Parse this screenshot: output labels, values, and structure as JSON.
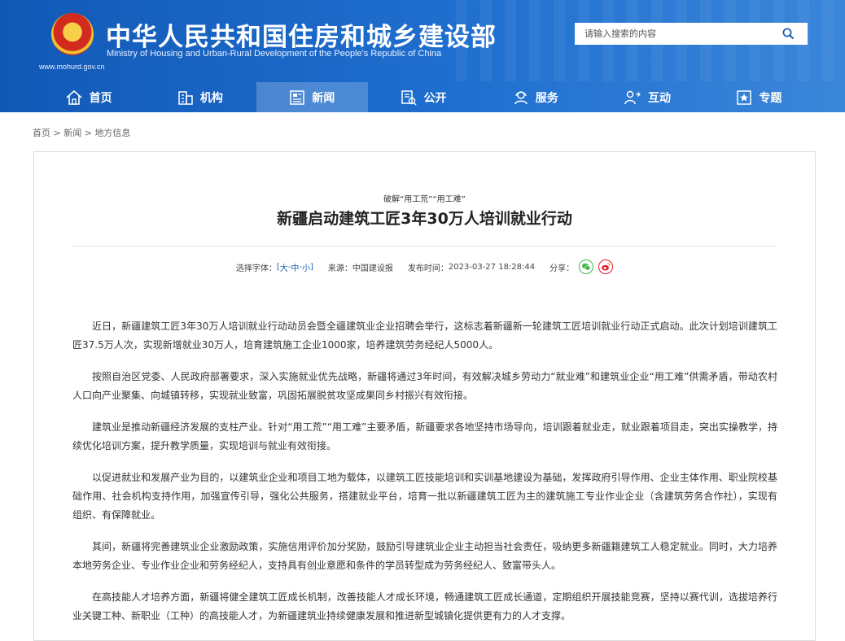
{
  "header": {
    "title": "中华人民共和国住房和城乡建设部",
    "subtitle": "Ministry of Housing and Urban-Rural Development of the People's Republic of China",
    "url": "www.mohurd.gov.cn",
    "search_placeholder": "请输入搜索的内容"
  },
  "nav": {
    "items": [
      {
        "label": "首页",
        "icon": "home-icon"
      },
      {
        "label": "机构",
        "icon": "org-icon"
      },
      {
        "label": "新闻",
        "icon": "news-icon",
        "active": true
      },
      {
        "label": "公开",
        "icon": "public-icon"
      },
      {
        "label": "服务",
        "icon": "service-icon"
      },
      {
        "label": "互动",
        "icon": "interact-icon"
      },
      {
        "label": "专题",
        "icon": "topic-icon"
      }
    ]
  },
  "breadcrumb": {
    "home": "首页",
    "sep": ">",
    "news": "新闻",
    "current": "地方信息"
  },
  "article": {
    "subtitle": "破解“用工荒”“用工难”",
    "title": "新疆启动建筑工匠3年30万人培训就业行动",
    "font_label": "选择字体：",
    "font_open": "[",
    "font_large": "大",
    "font_dash1": "-",
    "font_medium": "中",
    "font_dash2": "-",
    "font_small": "小",
    "font_close": "]",
    "source_label": "来源：",
    "source": "中国建设报",
    "time_label": "发布时间：",
    "time": "2023-03-27 18:28:44",
    "share_label": "分享：",
    "paragraphs": [
      "近日，新疆建筑工匠3年30万人培训就业行动动员会暨全疆建筑业企业招聘会举行，这标志着新疆新一轮建筑工匠培训就业行动正式启动。此次计划培训建筑工匠37.5万人次，实现新增就业30万人，培育建筑施工企业1000家，培养建筑劳务经纪人5000人。",
      "按照自治区党委、人民政府部署要求，深入实施就业优先战略，新疆将通过3年时间，有效解决城乡劳动力“就业难”和建筑业企业“用工难”供需矛盾，带动农村人口向产业聚集、向城镇转移，实现就业致富，巩固拓展脱贫攻坚成果同乡村振兴有效衔接。",
      "建筑业是推动新疆经济发展的支柱产业。针对“用工荒”“用工难”主要矛盾，新疆要求各地坚持市场导向，培训跟着就业走，就业跟着项目走，突出实操教学，持续优化培训方案，提升教学质量，实现培训与就业有效衔接。",
      "以促进就业和发展产业为目的，以建筑业企业和项目工地为载体，以建筑工匠技能培训和实训基地建设为基础，发挥政府引导作用、企业主体作用、职业院校基础作用、社会机构支持作用，加强宣传引导，强化公共服务，搭建就业平台，培育一批以新疆建筑工匠为主的建筑施工专业作业企业（含建筑劳务合作社），实现有组织、有保障就业。",
      "其间，新疆将完善建筑业企业激励政策，实施信用评价加分奖励，鼓励引导建筑业企业主动担当社会责任，吸纳更多新疆籍建筑工人稳定就业。同时，大力培养本地劳务企业、专业作业企业和劳务经纪人，支持具有创业意愿和条件的学员转型成为劳务经纪人、致富带头人。",
      "在高技能人才培养方面，新疆将健全建筑工匠成长机制，改善技能人才成长环境，畅通建筑工匠成长通道，定期组织开展技能竞赛，坚持以赛代训，选拔培养行业关键工种、新职业（工种）的高技能人才，为新疆建筑业持续健康发展和推进新型城镇化提供更有力的人才支撑。"
    ]
  }
}
